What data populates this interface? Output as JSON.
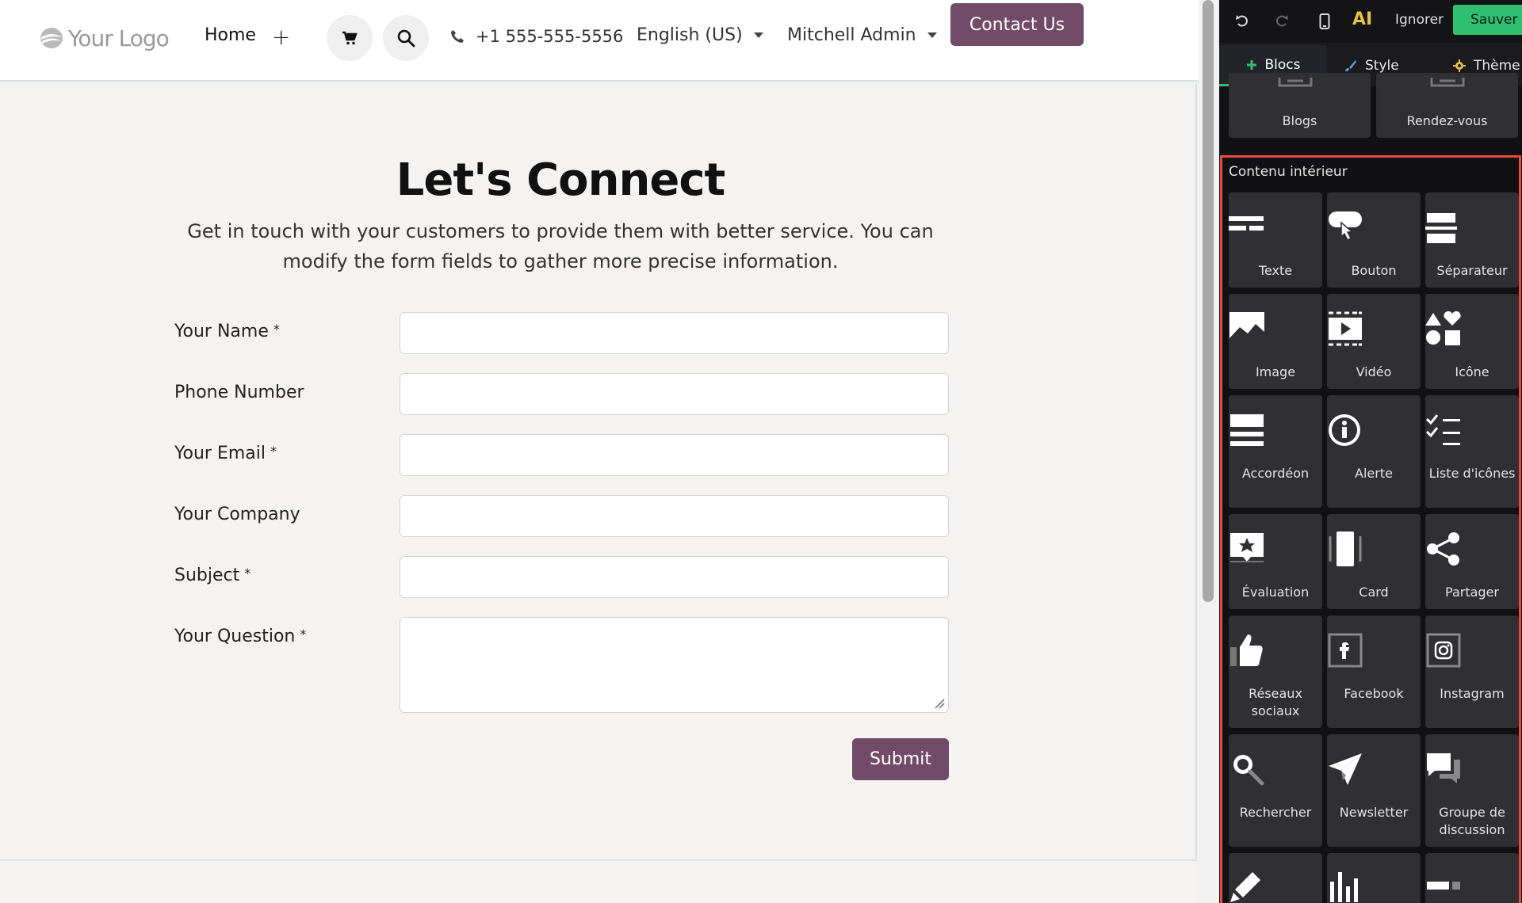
{
  "header": {
    "logo_text": "Your Logo",
    "nav_home": "Home",
    "nav_add": "+",
    "phone": "+1 555-555-5556",
    "language": "English (US)",
    "user": "Mitchell Admin",
    "contact_button": "Contact Us"
  },
  "main": {
    "title": "Let's Connect",
    "description": "Get in touch with your customers to provide them with better service. You can modify the form fields to gather more precise information.",
    "fields": [
      {
        "label": "Your Name",
        "required": "*"
      },
      {
        "label": "Phone Number",
        "required": ""
      },
      {
        "label": "Your Email",
        "required": "*"
      },
      {
        "label": "Your Company",
        "required": ""
      },
      {
        "label": "Subject",
        "required": "*"
      },
      {
        "label": "Your Question",
        "required": "*"
      }
    ],
    "submit_label": "Submit"
  },
  "editor": {
    "toolbar": {
      "ai_label": "AI",
      "discard_label": "Ignorer",
      "save_label": "Sauver"
    },
    "tabs": [
      {
        "label": "Blocs"
      },
      {
        "label": "Style"
      },
      {
        "label": "Thème"
      }
    ],
    "prev_blocks": [
      {
        "label": "Blogs"
      },
      {
        "label": "Rendez-vous"
      }
    ],
    "section_title": "Contenu intérieur",
    "blocks": [
      {
        "label": "Texte",
        "icon": "text-icon"
      },
      {
        "label": "Bouton",
        "icon": "button-icon"
      },
      {
        "label": "Séparateur",
        "icon": "separator-icon"
      },
      {
        "label": "Image",
        "icon": "image-icon"
      },
      {
        "label": "Vidéo",
        "icon": "video-icon"
      },
      {
        "label": "Icône",
        "icon": "shapes-icon"
      },
      {
        "label": "Accordéon",
        "icon": "accordion-icon"
      },
      {
        "label": "Alerte",
        "icon": "info-icon"
      },
      {
        "label": "Liste d'icônes",
        "icon": "checklist-icon"
      },
      {
        "label": "Évaluation",
        "icon": "rating-icon"
      },
      {
        "label": "Card",
        "icon": "card-icon"
      },
      {
        "label": "Partager",
        "icon": "share-icon"
      },
      {
        "label": "Réseaux sociaux",
        "icon": "thumbs-up-icon"
      },
      {
        "label": "Facebook",
        "icon": "facebook-icon"
      },
      {
        "label": "Instagram",
        "icon": "instagram-icon"
      },
      {
        "label": "Rechercher",
        "icon": "search-icon"
      },
      {
        "label": "Newsletter",
        "icon": "paper-plane-icon"
      },
      {
        "label": "Groupe de discussion",
        "icon": "chat-icon"
      },
      {
        "label": "",
        "icon": "pencil-icon"
      },
      {
        "label": "",
        "icon": "bar-chart-icon"
      },
      {
        "label": "",
        "icon": "progress-icon"
      }
    ]
  },
  "colors": {
    "brand": "#714b67",
    "save": "#2fbf71",
    "highlight": "#e64b3b"
  }
}
